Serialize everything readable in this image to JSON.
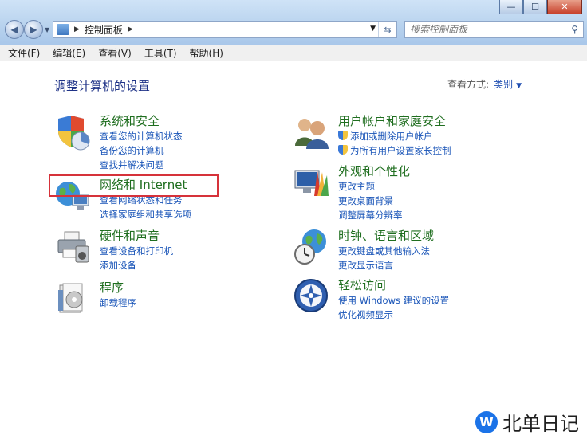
{
  "window": {
    "minimize": "—",
    "maximize": "☐",
    "close": "✕"
  },
  "address": {
    "breadcrumb": "控制面板"
  },
  "search": {
    "placeholder": "搜索控制面板"
  },
  "menu": [
    "文件(F)",
    "编辑(E)",
    "查看(V)",
    "工具(T)",
    "帮助(H)"
  ],
  "main": {
    "heading": "调整计算机的设置",
    "view_by_label": "查看方式:",
    "view_by_value": "类别"
  },
  "categories": [
    {
      "title": "系统和安全",
      "icon": "shield-chart-icon",
      "links": [
        "查看您的计算机状态",
        "备份您的计算机",
        "查找并解决问题"
      ]
    },
    {
      "title": "网络和 Internet",
      "icon": "network-globe-icon",
      "links": [
        "查看网络状态和任务",
        "选择家庭组和共享选项"
      ]
    },
    {
      "title": "硬件和声音",
      "icon": "printer-icon",
      "links": [
        "查看设备和打印机",
        "添加设备"
      ]
    },
    {
      "title": "程序",
      "icon": "programs-icon",
      "links": [
        "卸载程序"
      ]
    },
    {
      "title": "用户帐户和家庭安全",
      "icon": "users-icon",
      "links": [
        "添加或删除用户帐户",
        "为所有用户设置家长控制"
      ]
    },
    {
      "title": "外观和个性化",
      "icon": "appearance-icon",
      "links": [
        "更改主题",
        "更改桌面背景",
        "调整屏幕分辨率"
      ]
    },
    {
      "title": "时钟、语言和区域",
      "icon": "clock-globe-icon",
      "links": [
        "更改键盘或其他输入法",
        "更改显示语言"
      ]
    },
    {
      "title": "轻松访问",
      "icon": "ease-of-access-icon",
      "links": [
        "使用 Windows 建议的设置",
        "优化视频显示"
      ]
    }
  ],
  "watermark": {
    "logo": "W",
    "text": "北单日记"
  },
  "colors": {
    "category_title": "#1f6e1f",
    "link": "#1a55b8",
    "heading": "#1e3287",
    "highlight_box": "#d6323a"
  }
}
